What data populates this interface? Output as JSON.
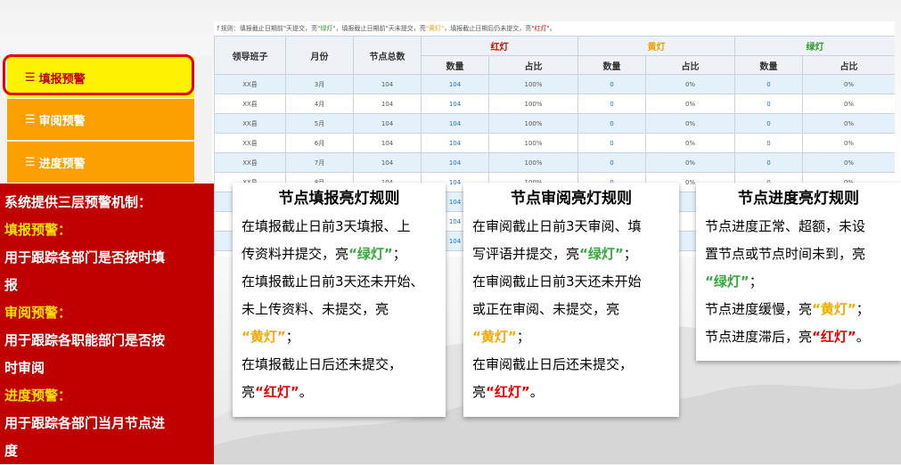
{
  "table": {
    "rule_text": {
      "prefix": "↑规则：填报截止日期前\"天提交，亮",
      "green": "\"绿灯\"",
      "mid": "，填报截止日期前\"天未提交，亮",
      "yellow": "\"黄灯\"",
      "mid2": "，填报截止日期后仍未提交，亮",
      "red": "\"红灯\"",
      "end": "。"
    },
    "headers": {
      "team": "领导班子",
      "month": "月份",
      "total": "节点总数",
      "red": "红灯",
      "yellow": "黄灯",
      "green": "绿灯",
      "qty": "数量",
      "ratio": "占比"
    },
    "rows": [
      [
        "XX县",
        "3月",
        "104",
        "104",
        "100%",
        "0",
        "0%",
        "0",
        "0%"
      ],
      [
        "XX县",
        "4月",
        "104",
        "104",
        "100%",
        "0",
        "0%",
        "0",
        "0%"
      ],
      [
        "XX县",
        "5月",
        "104",
        "104",
        "100%",
        "0",
        "0%",
        "0",
        "0%"
      ],
      [
        "XX县",
        "6月",
        "104",
        "104",
        "100%",
        "0",
        "0%",
        "0",
        "0%"
      ],
      [
        "XX县",
        "7月",
        "104",
        "104",
        "100%",
        "0",
        "0%",
        "0",
        "0%"
      ],
      [
        "XX县",
        "8月",
        "104",
        "104",
        "100%",
        "0",
        "0%",
        "0",
        "0%"
      ]
    ],
    "peek_left": [
      "104",
      "104",
      "104",
      "53"
    ],
    "peek_right": [
      "0%",
      "0%",
      "0%"
    ]
  },
  "menu": {
    "items": [
      {
        "label": "填报预警"
      },
      {
        "label": "审阅预警"
      },
      {
        "label": "进度预警"
      }
    ]
  },
  "desc": {
    "intro": "系统提供三层预警机制：",
    "l1_title": "填报预警：",
    "l1_a": "用于跟踪各部门是否按时填",
    "l1_b": "报",
    "l2_title": "审阅预警：",
    "l2_a": "用于跟踪各职能部门是否按",
    "l2_b": "时审阅",
    "l3_title": "进度预警：",
    "l3_a": "用于跟踪各部门当月节点进",
    "l3_b": "度"
  },
  "cards": {
    "c1": {
      "title": "节点填报亮灯规则",
      "l1": "在填报截止日前3天填报、上",
      "l2": "传资料并提交，亮",
      "l2q": "“绿灯”",
      "l2e": "；",
      "l3": "在填报截止日前3天还未开始、",
      "l4": "未上传资料、未提交，亮",
      "l5q": "“黄灯”",
      "l5e": "；",
      "l6": "在填报截止日后还未提交，",
      "l7": "亮",
      "l7q": "“红灯”",
      "l7e": "。"
    },
    "c2": {
      "title": "节点审阅亮灯规则",
      "l1": "在审阅截止日前3天审阅、填",
      "l2": "写评语并提交，亮",
      "l2q": "“绿灯”",
      "l2e": "；",
      "l3": "在审阅截止日前3天还未开始",
      "l4": "或正在审阅、未提交，亮",
      "l5q": "“黄灯”",
      "l5e": "；",
      "l6": "在审阅截止日后还未提交，",
      "l7": "亮",
      "l7q": "“红灯”",
      "l7e": "。"
    },
    "c3": {
      "title": "节点进度亮灯规则",
      "l1": "节点进度正常、超额，未设",
      "l2": "置节点或节点时间未到，亮",
      "l3q": "“绿灯”",
      "l3e": "；",
      "l4": "节点进度缓慢，亮",
      "l4q": "“黄灯”",
      "l4e": "；",
      "l5": "节点进度滞后，亮",
      "l5q": "“红灯”",
      "l5e": "。"
    }
  },
  "colors": {
    "menu_orange": "#fc9f00",
    "menu_active": "#fff200",
    "panel_red": "#c00000",
    "accent_yellow": "#ffe100",
    "green_light": "#34a838",
    "yellow_light": "#f5a800",
    "red_light": "#e60000"
  }
}
